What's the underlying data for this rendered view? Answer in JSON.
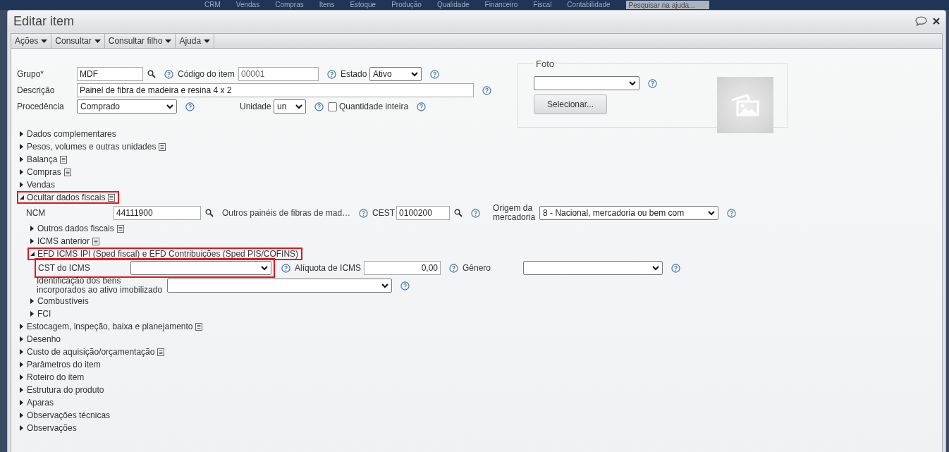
{
  "background_menu": {
    "items": [
      "CRM",
      "Vendas",
      "Compras",
      "Itens",
      "Estoque",
      "Produção",
      "Qualidade",
      "Financeiro",
      "Fiscal",
      "Contabilidade"
    ],
    "search": {
      "placeholder": "Pesquisar na ajuda..."
    }
  },
  "window": {
    "title": "Editar item"
  },
  "toolbar": [
    "Ações",
    "Consultar",
    "Consultar filho",
    "Ajuda"
  ],
  "form_rows": [
    [
      {
        "kind": "lookup",
        "label": "Grupo*",
        "value": "MDF",
        "help": true
      },
      {
        "kind": "input",
        "label": "Código do item",
        "value": "00001",
        "disabled": true,
        "help": true
      },
      {
        "kind": "select",
        "label": "Estado",
        "value": "Ativo",
        "help": true
      }
    ],
    [
      {
        "kind": "input",
        "label": "Descrição",
        "value": "Painel de fibra de madeira e resina 4 x 2",
        "help": true
      }
    ],
    [
      {
        "kind": "select",
        "label": "Procedência",
        "value": "Comprado",
        "help": true
      },
      {
        "kind": "select",
        "label": "Unidade",
        "value": "un",
        "help": true
      },
      {
        "kind": "checkbox",
        "label": "Quantidade inteira",
        "checked": false,
        "help": true
      }
    ]
  ],
  "photo": {
    "legend": "Foto",
    "select": {
      "help": true
    },
    "button": "Selecionar..."
  },
  "sections": [
    {
      "label": "Dados complementares",
      "expanded": false,
      "notes": false,
      "highlighted": false
    },
    {
      "label": "Pesos, volumes e outras unidades",
      "expanded": false,
      "notes": true,
      "highlighted": false
    },
    {
      "label": "Balança",
      "expanded": false,
      "notes": true,
      "highlighted": false
    },
    {
      "label": "Compras",
      "expanded": false,
      "notes": true,
      "highlighted": false
    },
    {
      "label": "Vendas",
      "expanded": false,
      "notes": false,
      "highlighted": false
    },
    {
      "label": "Ocultar dados fiscais",
      "expanded": true,
      "notes": true,
      "highlighted": true,
      "rows": [
        [
          {
            "kind": "lookup",
            "label": "NCM",
            "value": "44111900",
            "help": false
          },
          {
            "kind": "text",
            "value": "Outros painéis de fibras de mad…",
            "help": true
          },
          {
            "kind": "lookup",
            "label": "CEST",
            "value": "0100200",
            "help": true
          },
          {
            "kind": "select",
            "label": "Origem da mercadoria",
            "value": "8 - Nacional, mercadoria ou bem com",
            "help": true
          }
        ]
      ],
      "children": [
        {
          "label": "Outros dados fiscais",
          "expanded": false,
          "notes": true,
          "highlighted": false
        },
        {
          "label": "ICMS anterior",
          "expanded": false,
          "notes": true,
          "highlighted": false
        },
        {
          "label": "EFD ICMS IPI (Sped fiscal) e EFD Contribuições (Sped PIS/COFINS)",
          "expanded": true,
          "notes": false,
          "highlighted": true,
          "rows": [
            [
              {
                "kind": "select",
                "label": "CST do ICMS",
                "help": true,
                "highlighted": true
              },
              {
                "kind": "input",
                "label": "Alíquota de ICMS",
                "value": "0,00",
                "right_aligned": true,
                "help": true
              },
              {
                "kind": "select",
                "label": "Gênero",
                "help": true
              }
            ],
            [
              {
                "kind": "select",
                "label": "Identificação dos bens incorporados ao ativo imobilizado",
                "help": true
              }
            ]
          ]
        },
        {
          "label": "Combustíveis",
          "expanded": false,
          "notes": false,
          "highlighted": false
        },
        {
          "label": "FCI",
          "expanded": false,
          "notes": false,
          "highlighted": false
        }
      ]
    },
    {
      "label": "Estocagem, inspeção, baixa e planejamento",
      "expanded": false,
      "notes": true,
      "highlighted": false
    },
    {
      "label": "Desenho",
      "expanded": false,
      "notes": false,
      "highlighted": false
    },
    {
      "label": "Custo de aquisição/orçamentação",
      "expanded": false,
      "notes": true,
      "highlighted": false
    },
    {
      "label": "Parâmetros do item",
      "expanded": false,
      "notes": false,
      "highlighted": false
    },
    {
      "label": "Roteiro do item",
      "expanded": false,
      "notes": false,
      "highlighted": false
    },
    {
      "label": "Estrutura do produto",
      "expanded": false,
      "notes": false,
      "highlighted": false
    },
    {
      "label": "Aparas",
      "expanded": false,
      "notes": false,
      "highlighted": false
    },
    {
      "label": "Observações técnicas",
      "expanded": false,
      "notes": false,
      "highlighted": false
    },
    {
      "label": "Observações",
      "expanded": false,
      "notes": false,
      "highlighted": false
    }
  ]
}
